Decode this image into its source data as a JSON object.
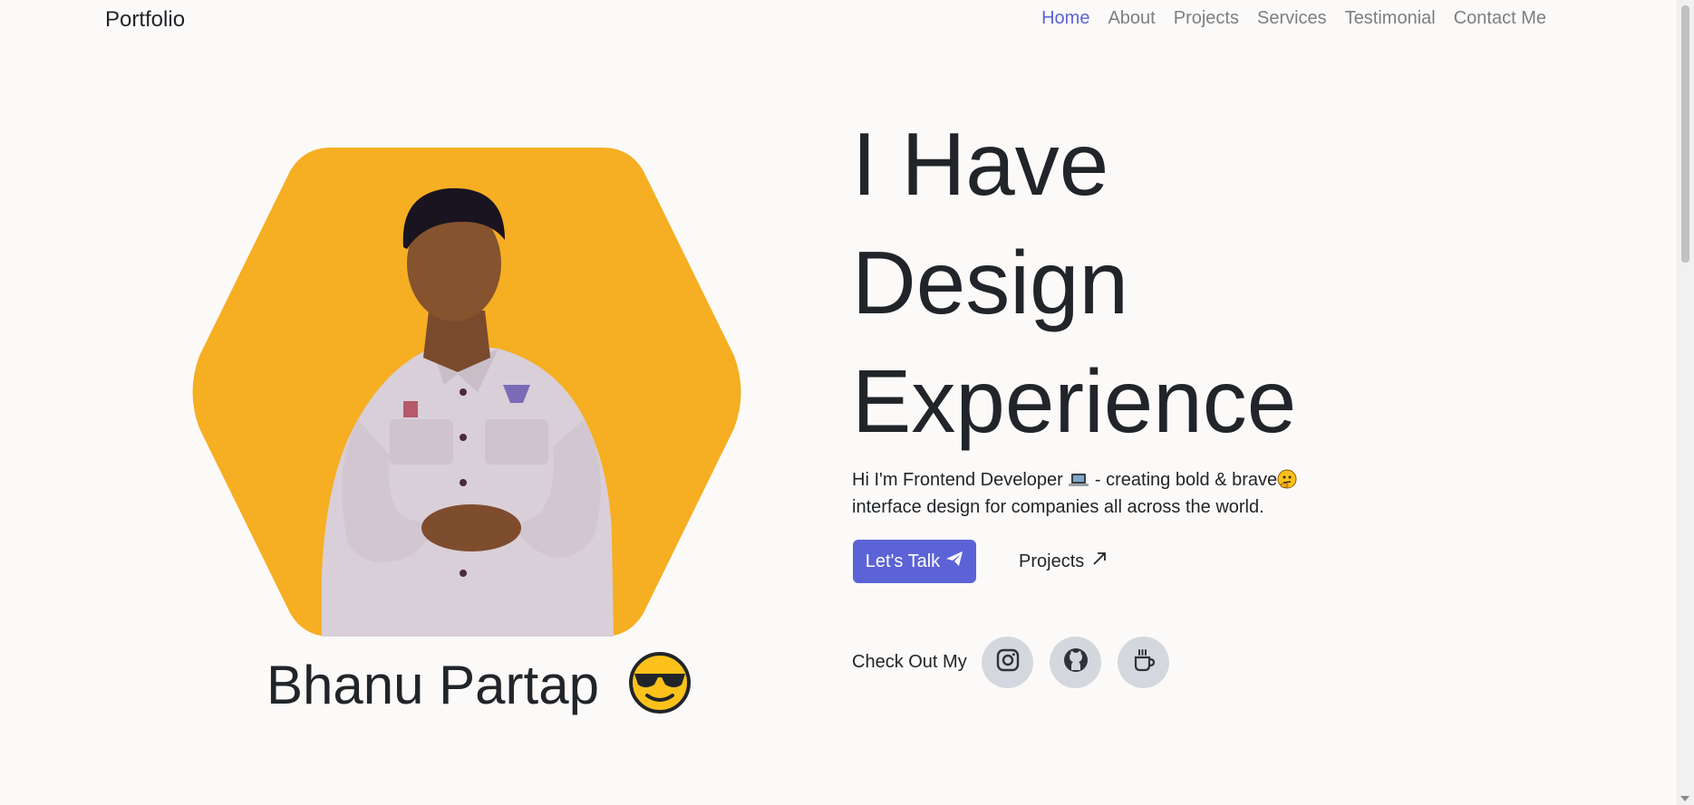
{
  "navbar": {
    "brand": "Portfolio",
    "links": [
      "Home",
      "About",
      "Projects",
      "Services",
      "Testimonial",
      "Contact Me"
    ],
    "active": "Home"
  },
  "profile": {
    "name": "Bhanu Partap",
    "name_emoji": "smiling-face-with-sunglasses-icon",
    "hexagon_color": "#f6ae22"
  },
  "hero": {
    "headline": [
      "I Have",
      "Design",
      "Experience"
    ],
    "intro_part1": "Hi I'm Frontend Developer",
    "intro_part2": " - creating bold & brave",
    "intro_part3": "interface design for companies all across the world.",
    "cta_primary": "Let's Talk",
    "cta_secondary": "Projects"
  },
  "social": {
    "label": "Check Out My",
    "icons": [
      "instagram-icon",
      "github-icon",
      "coffee-cup-icon"
    ]
  },
  "colors": {
    "accent": "#5c63d6",
    "background": "#fcfaf9",
    "social_bg": "#d4d8de"
  }
}
